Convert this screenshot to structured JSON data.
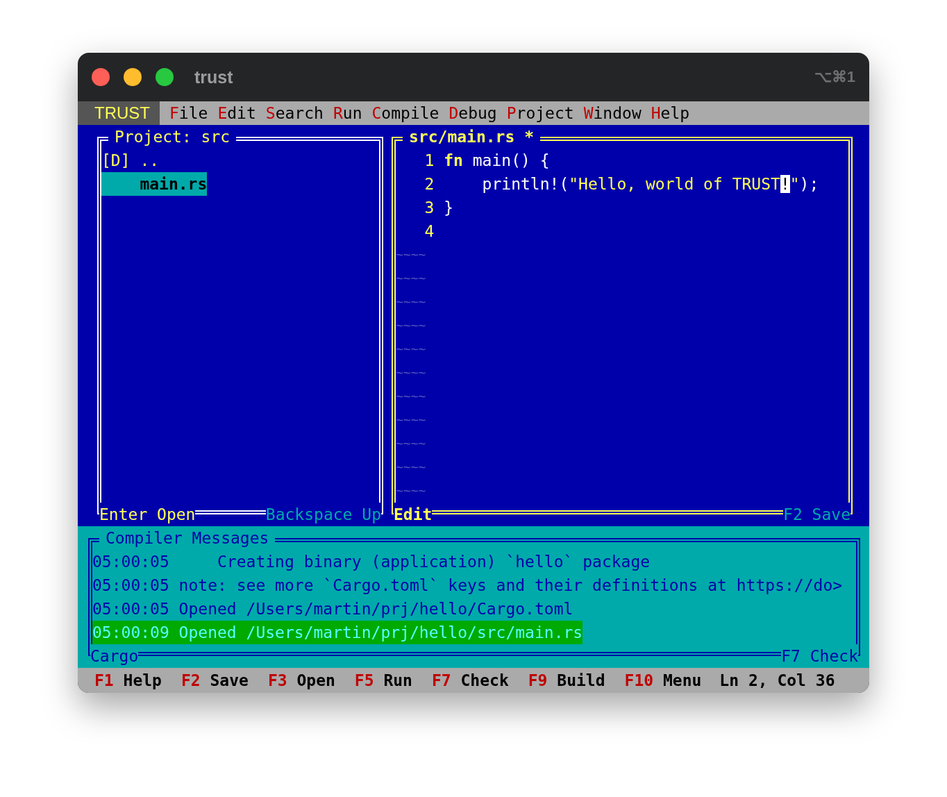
{
  "window": {
    "title": "trust",
    "shortcut": "⌥⌘1"
  },
  "menu": {
    "app": "TRUST",
    "items": [
      {
        "hotkey": "F",
        "rest": "ile"
      },
      {
        "hotkey": "E",
        "rest": "dit"
      },
      {
        "hotkey": "S",
        "rest": "earch"
      },
      {
        "hotkey": "R",
        "rest": "un"
      },
      {
        "hotkey": "C",
        "rest": "ompile"
      },
      {
        "hotkey": "D",
        "rest": "ebug"
      },
      {
        "hotkey": "P",
        "rest": "roject"
      },
      {
        "hotkey": "W",
        "rest": "indow"
      },
      {
        "hotkey": "H",
        "rest": "elp"
      }
    ]
  },
  "project_panel": {
    "title": "Project: src",
    "items": [
      {
        "kind": "dir",
        "label": "[D] ..",
        "selected": false
      },
      {
        "kind": "file",
        "label": "main.rs",
        "selected": true
      }
    ],
    "footer_left": "Enter Open",
    "footer_right": "Backspace Up"
  },
  "editor": {
    "title": "src/main.rs *",
    "lines": [
      {
        "number": "1",
        "tokens": [
          {
            "kind": "keyword",
            "text": "fn"
          },
          {
            "kind": "plain",
            "text": " main() {"
          }
        ]
      },
      {
        "number": "2",
        "tokens": [
          {
            "kind": "plain",
            "text": "    println!("
          },
          {
            "kind": "string",
            "text": "\"Hello, world of TRUST"
          },
          {
            "kind": "cursor",
            "text": "!"
          },
          {
            "kind": "string",
            "text": "\""
          },
          {
            "kind": "plain",
            "text": ");"
          }
        ]
      },
      {
        "number": "3",
        "tokens": [
          {
            "kind": "plain",
            "text": "}"
          }
        ]
      },
      {
        "number": "4"
      }
    ],
    "empty_markers": [
      "~~~~",
      "~~~~",
      "~~~~",
      "~~~~",
      "~~~~",
      "~~~~",
      "~~~~",
      "~~~~",
      "~~~~",
      "~~~~",
      "~~~~"
    ],
    "footer_left": "Edit",
    "footer_right": "F2 Save"
  },
  "compiler": {
    "title": "Compiler Messages",
    "messages": [
      {
        "text": "05:00:05     Creating binary (application) `hello` package",
        "selected": false
      },
      {
        "text": "05:00:05 note: see more `Cargo.toml` keys and their definitions at https://do>",
        "selected": false
      },
      {
        "text": "05:00:05 Opened /Users/martin/prj/hello/Cargo.toml",
        "selected": false
      },
      {
        "text": "05:00:09 Opened /Users/martin/prj/hello/src/main.rs",
        "selected": true
      }
    ],
    "footer_left": "Cargo",
    "footer_right": "F7 Check"
  },
  "status_bar": {
    "keys": [
      {
        "key": "F1",
        "label": "Help"
      },
      {
        "key": "F2",
        "label": "Save"
      },
      {
        "key": "F3",
        "label": "Open"
      },
      {
        "key": "F5",
        "label": "Run"
      },
      {
        "key": "F7",
        "label": "Check"
      },
      {
        "key": "F9",
        "label": "Build"
      },
      {
        "key": "F10",
        "label": "Menu"
      }
    ],
    "position": "Ln 2, Col 36"
  }
}
